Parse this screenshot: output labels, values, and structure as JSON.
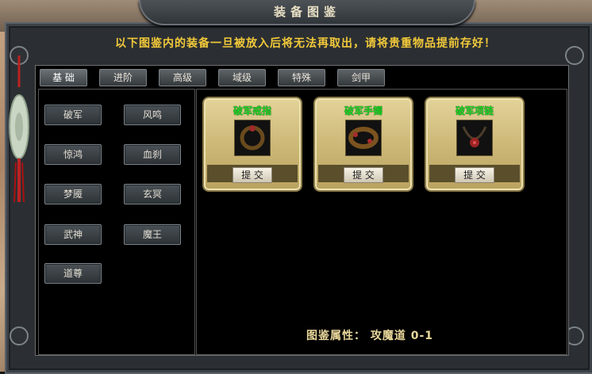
{
  "window": {
    "title": "装备图鉴",
    "notice": "以下图鉴内的装备一旦被放入后将无法再取出，请将贵重物品提前存好！"
  },
  "tabs": [
    {
      "label": "基 础",
      "active": true
    },
    {
      "label": "进阶",
      "active": false
    },
    {
      "label": "高级",
      "active": false
    },
    {
      "label": "域级",
      "active": false
    },
    {
      "label": "特殊",
      "active": false
    },
    {
      "label": "剑甲",
      "active": false
    }
  ],
  "categories": [
    "破军",
    "风鸣",
    "惊鸿",
    "血刹",
    "梦魇",
    "玄冥",
    "武神",
    "魔王",
    "道尊"
  ],
  "items": [
    {
      "name": "破军戒指",
      "button": "提 交",
      "icon": "ring-icon"
    },
    {
      "name": "破军手镯",
      "button": "提 交",
      "icon": "bracelet-icon"
    },
    {
      "name": "破军项链",
      "button": "提 交",
      "icon": "necklace-icon"
    }
  ],
  "attribute": "图鉴属性： 攻魔道  0-1",
  "colors": {
    "notice": "#f2c93a",
    "item_name": "#18d420",
    "card_gold": "#cdb877",
    "attribute": "#e9d89b"
  }
}
